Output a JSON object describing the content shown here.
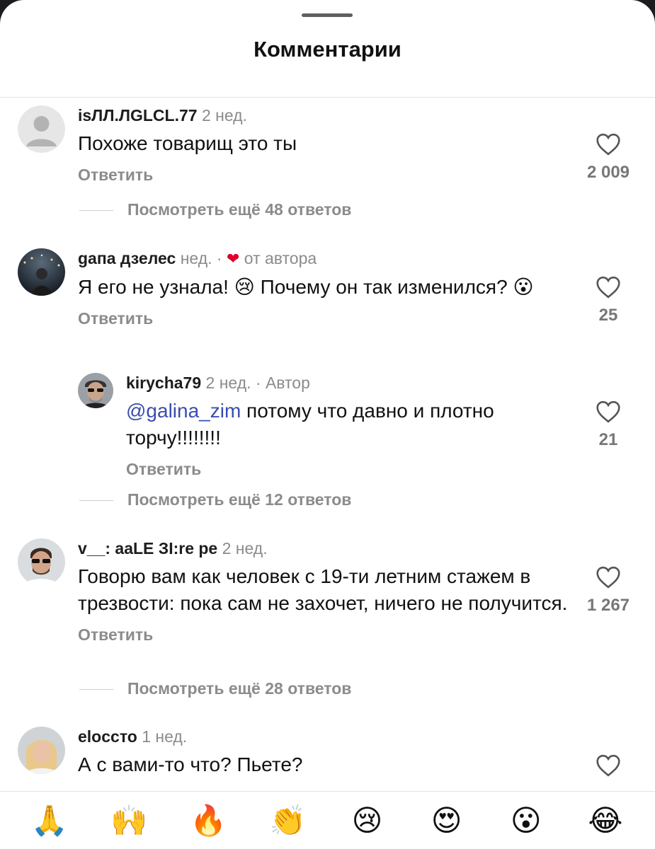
{
  "header": {
    "title": "Комментарии"
  },
  "comments": [
    {
      "username": "isЛЛ.ЛGLCL.77",
      "time": "2 нед.",
      "text": "Похоже товарищ это ты",
      "reply_label": "Ответить",
      "likes": "2 009",
      "view_more": "Посмотреть ещё 48 ответов"
    },
    {
      "username": "gапа дзелес",
      "time": "нед.",
      "separator": "·",
      "author_like_label": "от автора",
      "text": "Я его не узнала! 😢 Почему он так изменился? 😮",
      "reply_label": "Ответить",
      "likes": "25"
    },
    {
      "username": "kirycha79",
      "time": "2 нед.",
      "separator": "·",
      "author_label": "Автор",
      "mention": "@galina_zim",
      "text": " потому что давно и плотно торчу!!!!!!!!",
      "reply_label": "Ответить",
      "likes": "21",
      "view_more": "Посмотреть ещё 12 ответов"
    },
    {
      "username": "v__: ааLE ЗI:re ре",
      "time": "2 нед.",
      "text": "Говорю вам как человек с 19-ти летним стажем в трезвости: пока сам не захочет, ничего не получится.",
      "reply_label": "Ответить",
      "likes": "1 267",
      "view_more": "Посмотреть ещё 28 ответов"
    },
    {
      "username": "elocсто",
      "time": "1 нед.",
      "text": "А с вами-то что? Пьете?"
    }
  ],
  "emoji_bar": [
    "🙏",
    "🙌",
    "🔥",
    "👏",
    "😢",
    "😍",
    "😮",
    "😂"
  ],
  "colors": {
    "mention": "#3a4db0",
    "author_heart": "#e0002a",
    "muted": "#8b8b8b"
  }
}
